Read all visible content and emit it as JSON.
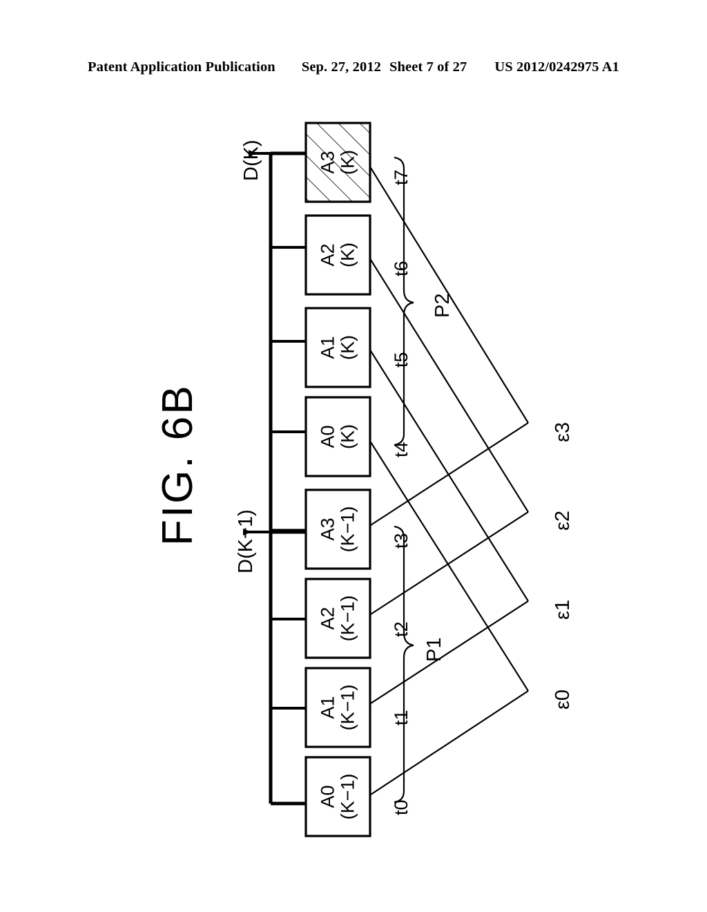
{
  "header": {
    "publication": "Patent Application Publication",
    "date": "Sep. 27, 2012",
    "sheet": "Sheet 7 of 27",
    "number": "US 2012/0242975 A1"
  },
  "figure": {
    "title": "FIG. 6B",
    "bus_labels": [
      {
        "id": "d-k",
        "text": "D(K)"
      },
      {
        "id": "d-k-1",
        "text": "D(K−1)"
      }
    ],
    "boxes": [
      {
        "id": "box-a3-k",
        "line1": "A3",
        "line2": "(K)",
        "hatched": true,
        "tick": "t7"
      },
      {
        "id": "box-a2-k",
        "line1": "A2",
        "line2": "(K)",
        "hatched": false,
        "tick": "t6"
      },
      {
        "id": "box-a1-k",
        "line1": "A1",
        "line2": "(K)",
        "hatched": false,
        "tick": "t5"
      },
      {
        "id": "box-a0-k",
        "line1": "A0",
        "line2": "(K)",
        "hatched": false,
        "tick": "t4"
      },
      {
        "id": "box-a3-k-1",
        "line1": "A3",
        "line2": "(K−1)",
        "hatched": false,
        "tick": "t3"
      },
      {
        "id": "box-a2-k-1",
        "line1": "A2",
        "line2": "(K−1)",
        "hatched": false,
        "tick": "t2"
      },
      {
        "id": "box-a1-k-1",
        "line1": "A1",
        "line2": "(K−1)",
        "hatched": false,
        "tick": "t1"
      },
      {
        "id": "box-a0-k-1",
        "line1": "A0",
        "line2": "(K−1)",
        "hatched": false,
        "tick": "t0"
      }
    ],
    "periods": [
      {
        "id": "p2",
        "label": "P2",
        "spans": "t4–t7"
      },
      {
        "id": "p1",
        "label": "P1",
        "spans": "t0–t3"
      }
    ],
    "epsilons": [
      {
        "id": "eps3",
        "label": "ε3"
      },
      {
        "id": "eps2",
        "label": "ε2"
      },
      {
        "id": "eps1",
        "label": "ε1"
      },
      {
        "id": "eps0",
        "label": "ε0"
      }
    ],
    "colors": {
      "ink": "#000000",
      "paper": "#ffffff"
    }
  }
}
